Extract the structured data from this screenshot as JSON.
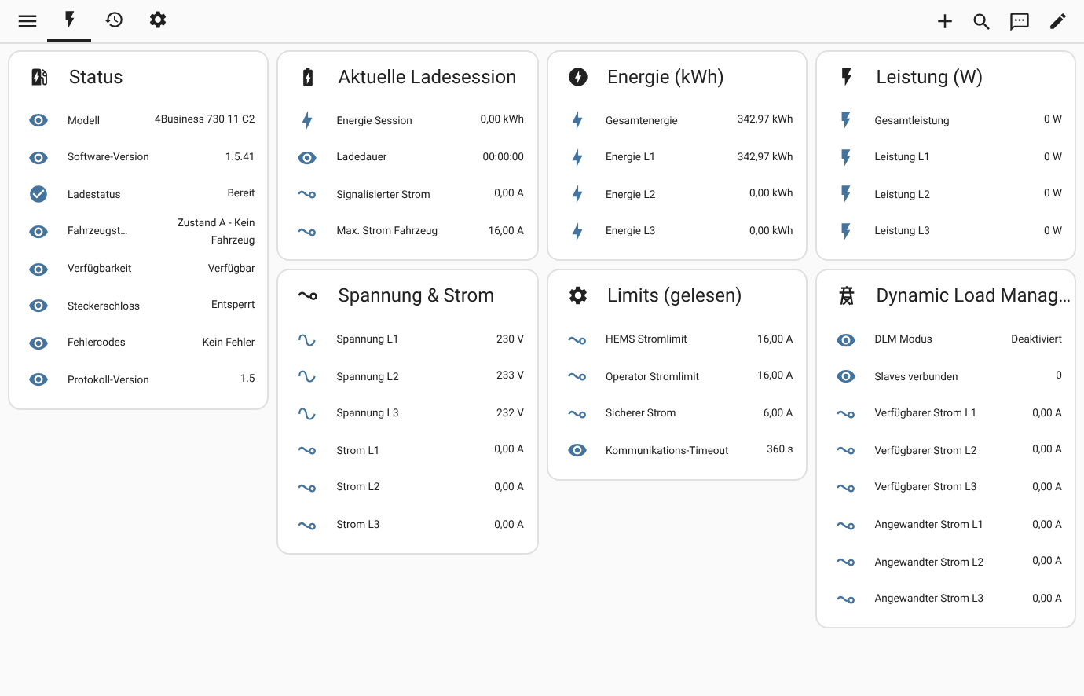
{
  "top_bar": {
    "tabs": [
      {
        "selected": true
      },
      {
        "selected": false
      },
      {
        "selected": false
      }
    ]
  },
  "columns": [
    {
      "cards": [
        {
          "title": "Status",
          "kind": "ev-station",
          "rows": [
            {
              "kind": "eye",
              "name": "Modell",
              "value": "4Business 730 11 C2"
            },
            {
              "kind": "eye",
              "name": "Software-Version",
              "value": "1.5.41"
            },
            {
              "kind": "check",
              "name": "Ladestatus",
              "value": "Bereit"
            },
            {
              "kind": "eye",
              "name": "Fahrzeugst…",
              "value": "Zustand A - Kein Fahrzeug"
            },
            {
              "kind": "eye",
              "name": "Verfügbarkeit",
              "value": "Verfügbar"
            },
            {
              "kind": "eye",
              "name": "Steckerschloss",
              "value": "Entsperrt"
            },
            {
              "kind": "eye",
              "name": "Fehlercodes",
              "value": "Kein Fehler"
            },
            {
              "kind": "eye",
              "name": "Protokoll-Version",
              "value": "1.5"
            }
          ]
        }
      ]
    },
    {
      "cards": [
        {
          "title": "Aktuelle Ladesession",
          "kind": "battery",
          "rows": [
            {
              "kind": "bolt",
              "name": "Energie Session",
              "value": "0,00 kWh"
            },
            {
              "kind": "eye",
              "name": "Ladedauer",
              "value": "00:00:00"
            },
            {
              "kind": "current",
              "name": "Signalisierter Strom",
              "value": "0,00 A"
            },
            {
              "kind": "current",
              "name": "Max. Strom Fahrzeug",
              "value": "16,00 A"
            }
          ]
        },
        {
          "title": "Spannung & Strom",
          "kind": "current",
          "rows": [
            {
              "kind": "sine",
              "name": "Spannung L1",
              "value": "230 V"
            },
            {
              "kind": "sine",
              "name": "Spannung L2",
              "value": "233 V"
            },
            {
              "kind": "sine",
              "name": "Spannung L3",
              "value": "232 V"
            },
            {
              "kind": "current",
              "name": "Strom L1",
              "value": "0,00 A"
            },
            {
              "kind": "current",
              "name": "Strom L2",
              "value": "0,00 A"
            },
            {
              "kind": "current",
              "name": "Strom L3",
              "value": "0,00 A"
            }
          ]
        }
      ]
    },
    {
      "cards": [
        {
          "title": "Energie (kWh)",
          "kind": "bolt-circle",
          "rows": [
            {
              "kind": "bolt",
              "name": "Gesamtenergie",
              "value": "342,97 kWh"
            },
            {
              "kind": "bolt",
              "name": "Energie L1",
              "value": "342,97 kWh"
            },
            {
              "kind": "bolt",
              "name": "Energie L2",
              "value": "0,00 kWh"
            },
            {
              "kind": "bolt",
              "name": "Energie L3",
              "value": "0,00 kWh"
            }
          ]
        },
        {
          "title": "Limits (gelesen)",
          "kind": "gear",
          "rows": [
            {
              "kind": "current",
              "name": "HEMS Stromlimit",
              "value": "16,00 A"
            },
            {
              "kind": "current",
              "name": "Operator Stromlimit",
              "value": "16,00 A"
            },
            {
              "kind": "current",
              "name": "Sicherer Strom",
              "value": "6,00 A"
            },
            {
              "kind": "eye",
              "name": "Kommunikations-Timeout",
              "value": "360 s"
            }
          ]
        }
      ]
    },
    {
      "cards": [
        {
          "title": "Leistung (W)",
          "kind": "flash",
          "rows": [
            {
              "kind": "flash",
              "name": "Gesamtleistung",
              "value": "0 W"
            },
            {
              "kind": "flash",
              "name": "Leistung L1",
              "value": "0 W"
            },
            {
              "kind": "flash",
              "name": "Leistung L2",
              "value": "0 W"
            },
            {
              "kind": "flash",
              "name": "Leistung L3",
              "value": "0 W"
            }
          ]
        },
        {
          "title": "Dynamic Load Manag…",
          "kind": "tower",
          "rows": [
            {
              "kind": "eye",
              "name": "DLM Modus",
              "value": "Deaktiviert"
            },
            {
              "kind": "eye",
              "name": "Slaves verbunden",
              "value": "0"
            },
            {
              "kind": "current",
              "name": "Verfügbarer Strom L1",
              "value": "0,00 A"
            },
            {
              "kind": "current",
              "name": "Verfügbarer Strom L2",
              "value": "0,00 A"
            },
            {
              "kind": "current",
              "name": "Verfügbarer Strom L3",
              "value": "0,00 A"
            },
            {
              "kind": "current",
              "name": "Angewandter Strom L1",
              "value": "0,00 A"
            },
            {
              "kind": "current",
              "name": "Angewandter Strom L2",
              "value": "0,00 A"
            },
            {
              "kind": "current",
              "name": "Angewandter Strom L3",
              "value": "0,00 A"
            }
          ]
        }
      ]
    }
  ]
}
